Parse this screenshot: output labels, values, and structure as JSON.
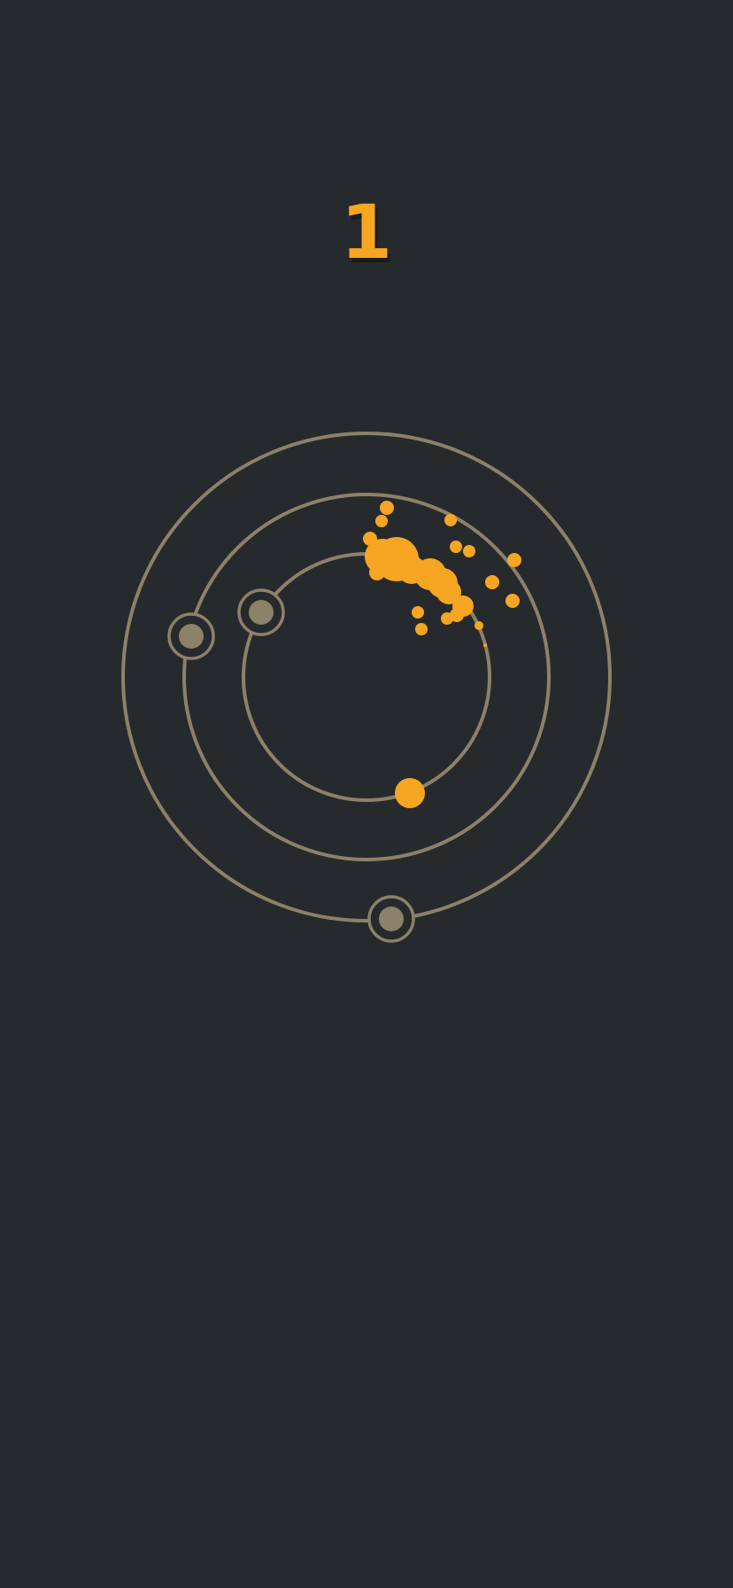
{
  "score": "1",
  "colors": {
    "background": "#272a2d",
    "ring": "#8c8169",
    "node_fill": "#8c8169",
    "player": "#f6a623",
    "score_text": "#f6a623"
  }
}
